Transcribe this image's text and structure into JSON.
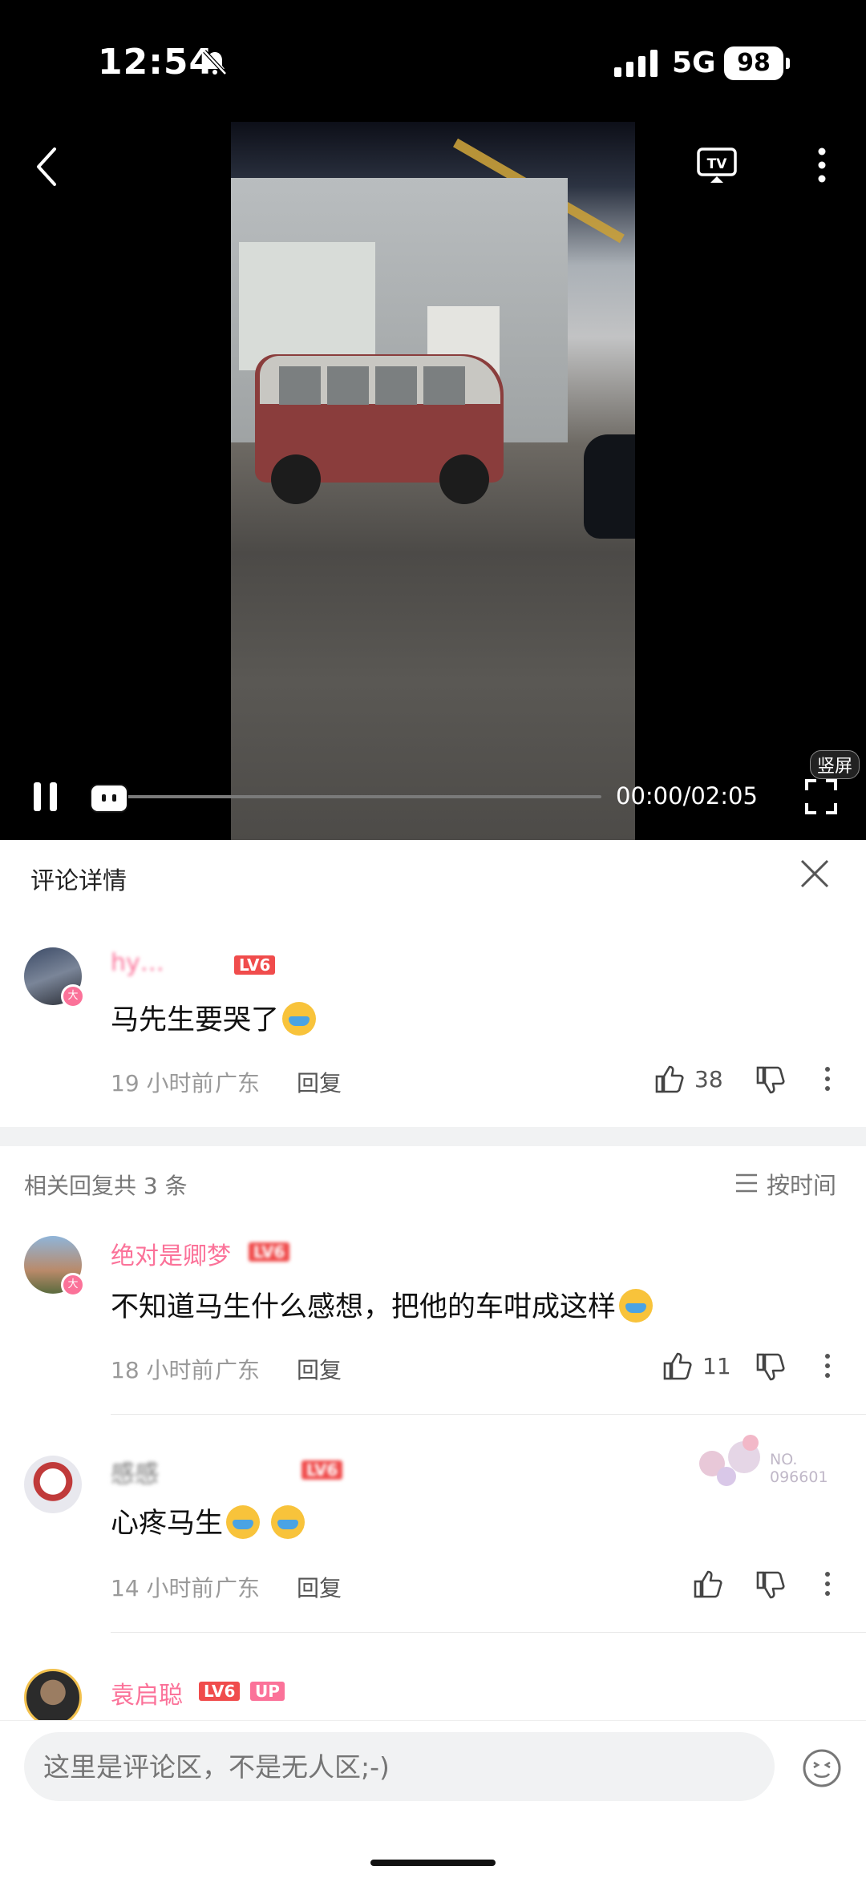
{
  "status": {
    "time": "12:54",
    "network": "5G",
    "battery": "98"
  },
  "video": {
    "current_time": "00:00",
    "duration": "02:05",
    "time_display": "00:00/02:05",
    "vertical_badge": "竖屏",
    "progress": 0.0
  },
  "sheet": {
    "title": "评论详情"
  },
  "main_comment": {
    "username": "hy…",
    "level": "LV6",
    "avatar_badge": "大",
    "text": "马先生要哭了",
    "time": "19 小时前",
    "location": "广东",
    "reply_label": "回复",
    "likes": "38"
  },
  "related": {
    "label": "相关回复共 3 条",
    "sort_label": "按时间"
  },
  "replies": [
    {
      "username": "绝对是卿梦",
      "level": "LV6",
      "avatar_badge": "大",
      "text": "不知道马生什么感想，把他的车咁成这样",
      "time": "18 小时前",
      "location": "广东",
      "reply_label": "回复",
      "likes": "11"
    },
    {
      "username": "感感",
      "level": "LV6",
      "text": "心疼马生",
      "time": "14 小时前",
      "location": "广东",
      "reply_label": "回复",
      "likes": "",
      "decoration_text": "NO. 096601"
    },
    {
      "username": "袁启聪",
      "level": "LV6",
      "up_badge": "UP"
    }
  ],
  "input": {
    "placeholder": "这里是评论区，不是无人区;-)"
  },
  "colors": {
    "accent_pink": "#fb7299",
    "level_red": "#f04c4c"
  }
}
